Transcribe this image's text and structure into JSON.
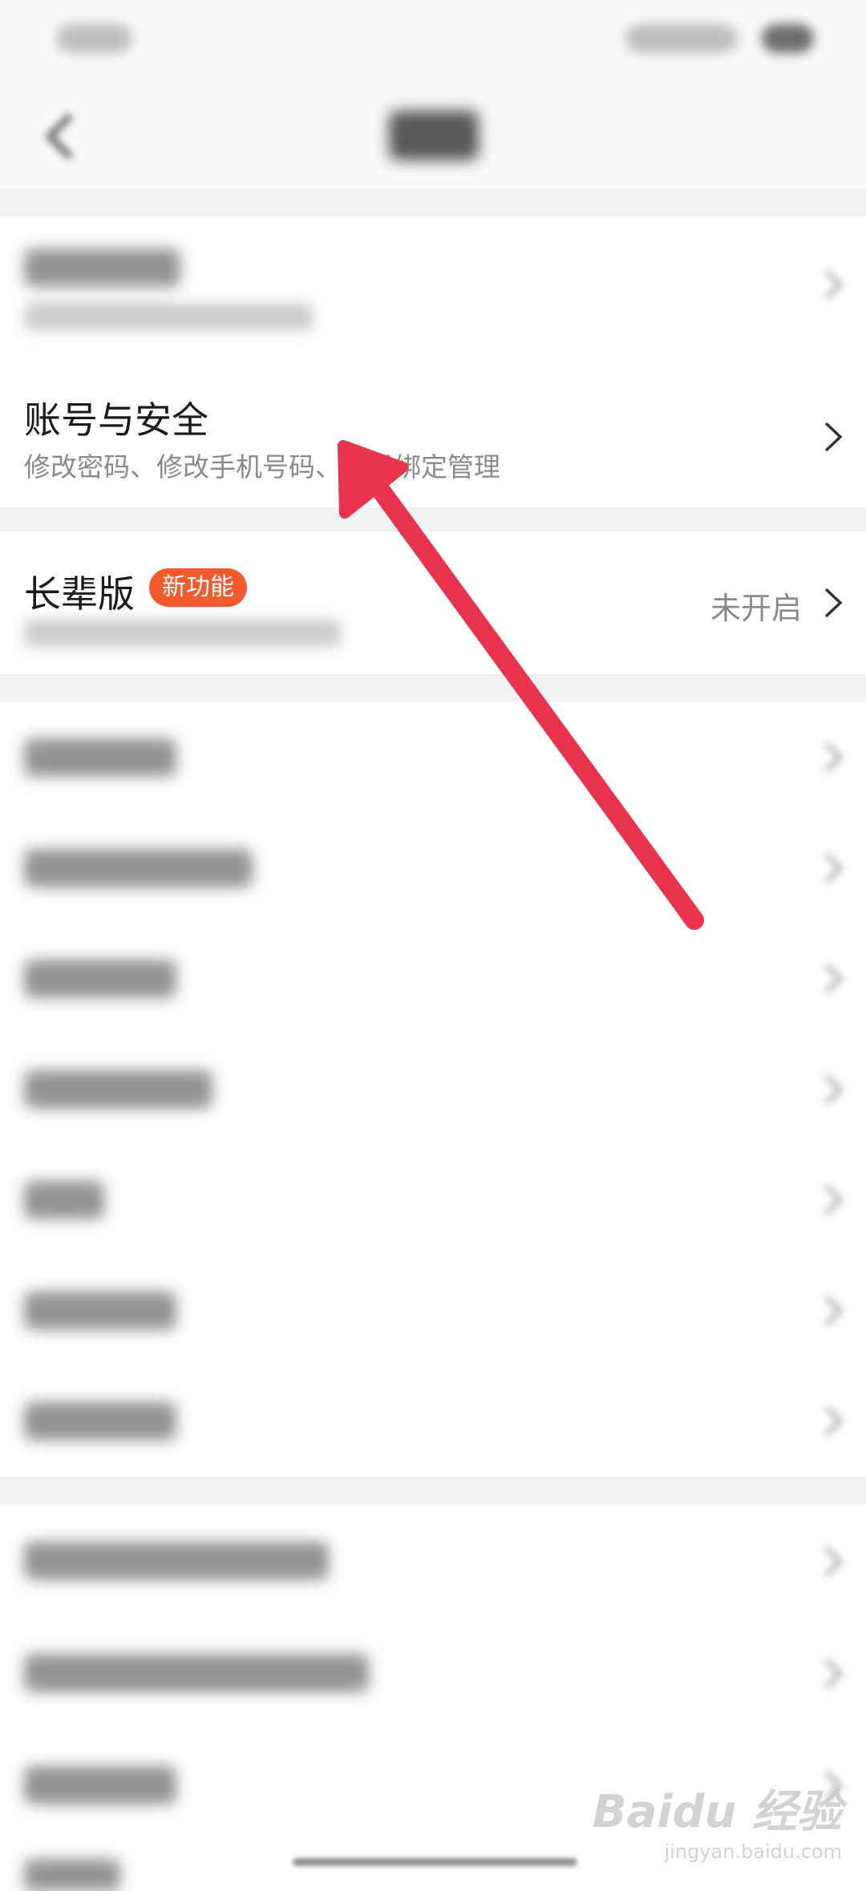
{
  "account_security": {
    "title": "账号与安全",
    "subtitle": "修改密码、修改手机号码、账号绑定管理"
  },
  "elder_mode": {
    "title": "长辈版",
    "badge": "新功能",
    "value": "未开启"
  },
  "watermark": {
    "logo": "Baidu 经验",
    "url": "jingyan.baidu.com"
  },
  "colors": {
    "badge": "#f25a2e",
    "arrow": "#e8334f",
    "section_gap": "#f2f2f2"
  },
  "icons": [
    "back-chevron-icon",
    "chevron-right-icon"
  ]
}
